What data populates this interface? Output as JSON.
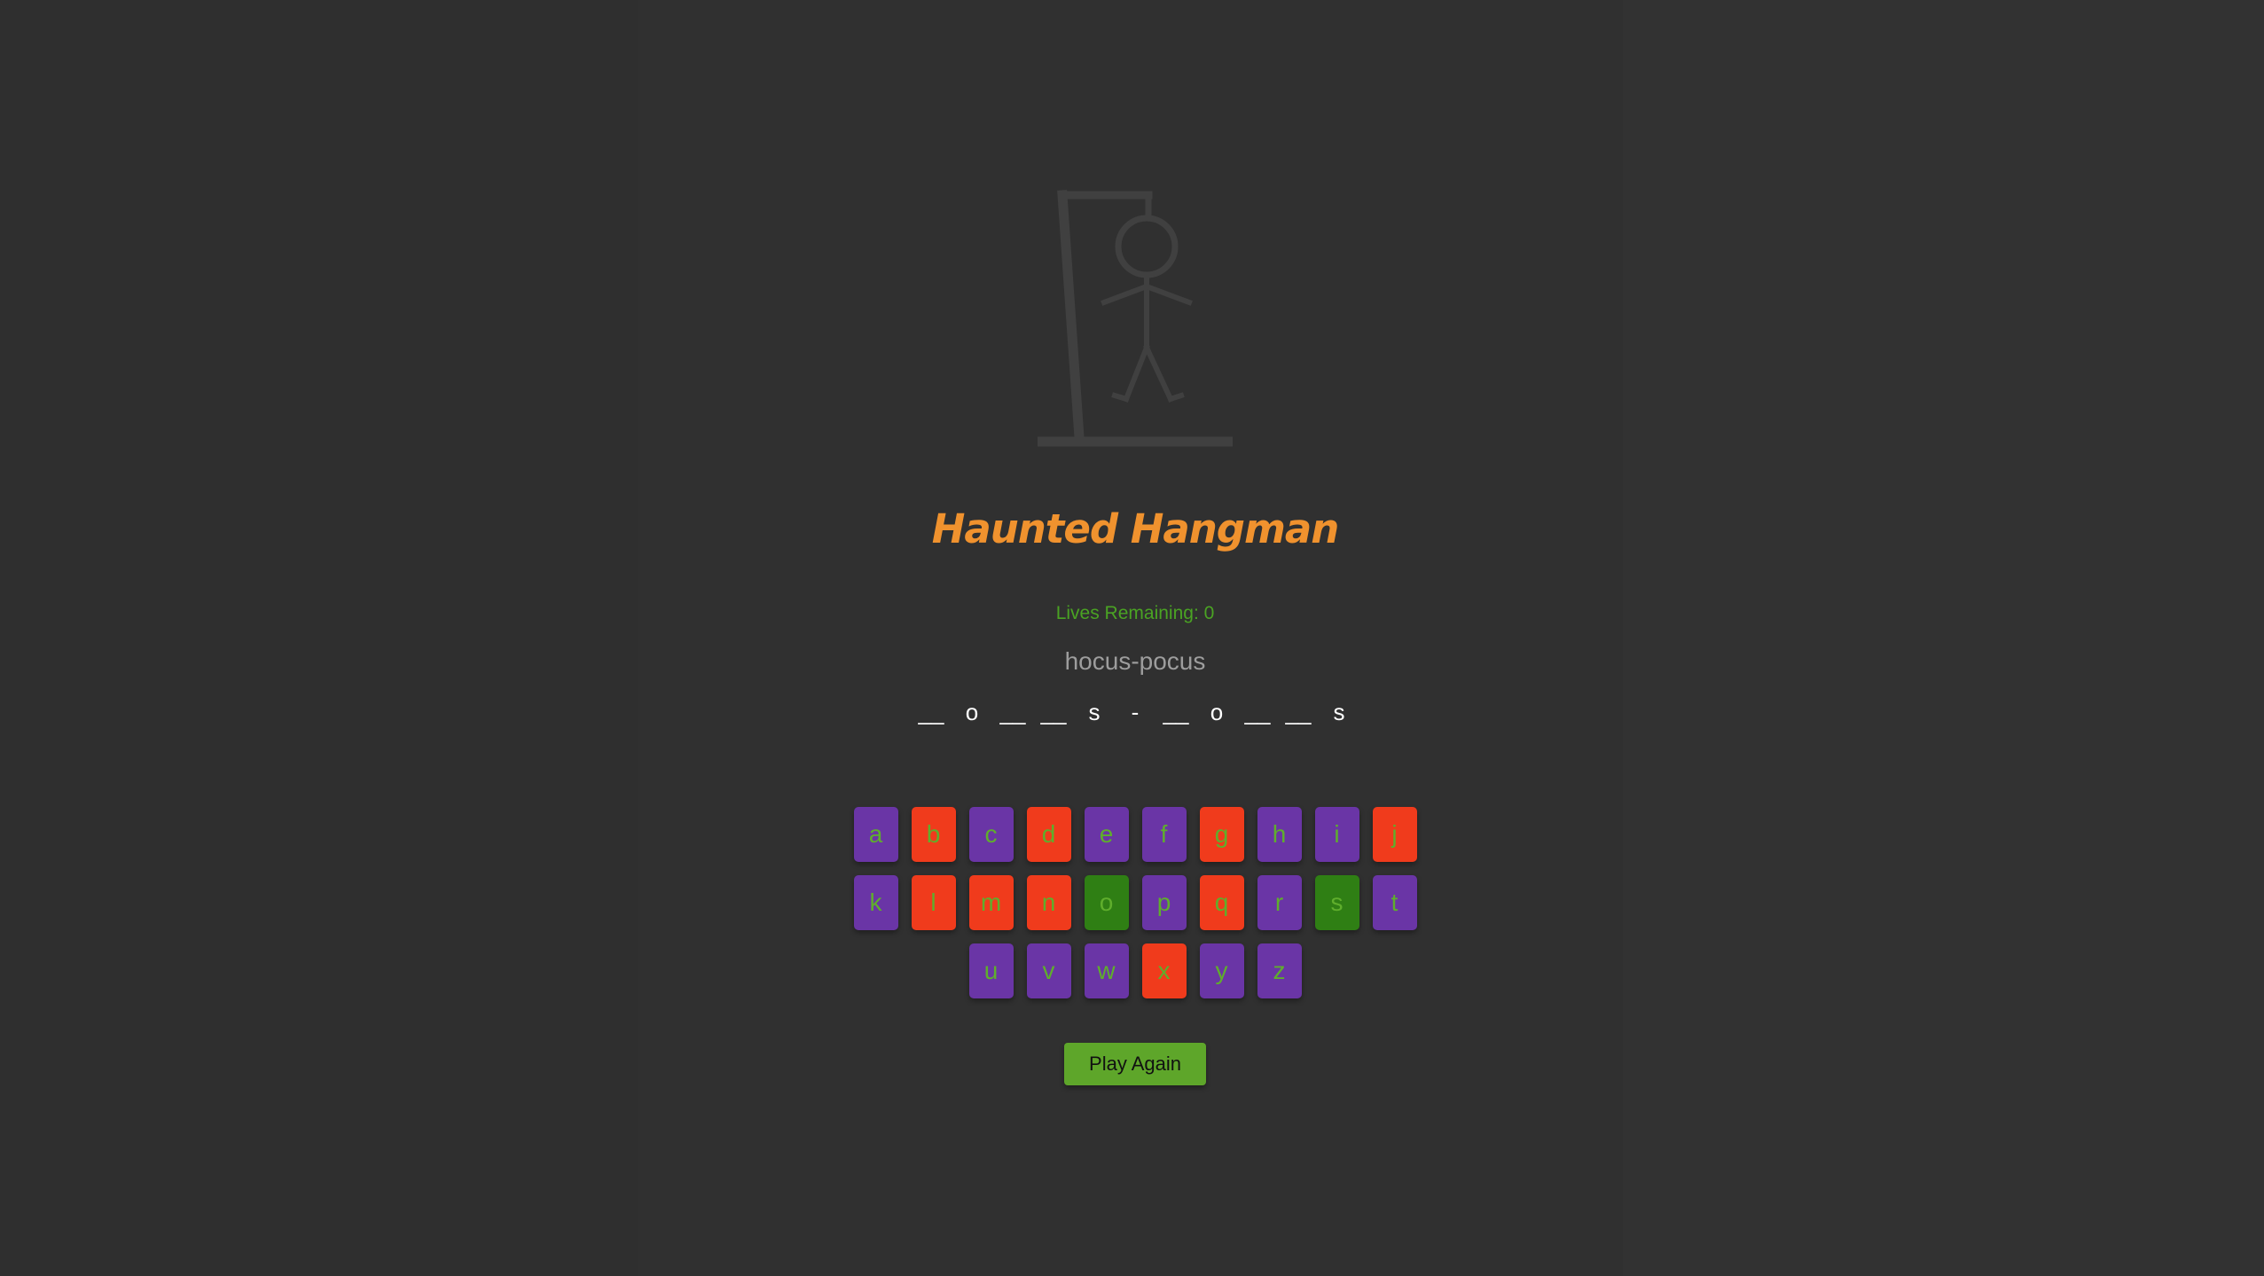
{
  "game": {
    "title": "Haunted Hangman",
    "lives_label": "Lives Remaining: 0",
    "hint": "hocus-pocus",
    "word_slots": [
      "__",
      "o",
      "__",
      "__",
      "s",
      "-",
      "__",
      "o",
      "__",
      "__",
      "s"
    ],
    "play_again_label": "Play Again"
  },
  "keyboard": {
    "rows": [
      [
        {
          "letter": "a",
          "state": "unused"
        },
        {
          "letter": "b",
          "state": "wrong"
        },
        {
          "letter": "c",
          "state": "unused"
        },
        {
          "letter": "d",
          "state": "wrong"
        },
        {
          "letter": "e",
          "state": "unused"
        },
        {
          "letter": "f",
          "state": "unused"
        },
        {
          "letter": "g",
          "state": "wrong"
        },
        {
          "letter": "h",
          "state": "unused"
        },
        {
          "letter": "i",
          "state": "unused"
        },
        {
          "letter": "j",
          "state": "wrong"
        }
      ],
      [
        {
          "letter": "k",
          "state": "unused"
        },
        {
          "letter": "l",
          "state": "wrong"
        },
        {
          "letter": "m",
          "state": "wrong"
        },
        {
          "letter": "n",
          "state": "wrong"
        },
        {
          "letter": "o",
          "state": "correct"
        },
        {
          "letter": "p",
          "state": "unused"
        },
        {
          "letter": "q",
          "state": "wrong"
        },
        {
          "letter": "r",
          "state": "unused"
        },
        {
          "letter": "s",
          "state": "correct"
        },
        {
          "letter": "t",
          "state": "unused"
        }
      ],
      [
        {
          "letter": "u",
          "state": "unused"
        },
        {
          "letter": "v",
          "state": "unused"
        },
        {
          "letter": "w",
          "state": "unused"
        },
        {
          "letter": "x",
          "state": "wrong"
        },
        {
          "letter": "y",
          "state": "unused"
        },
        {
          "letter": "z",
          "state": "unused"
        }
      ]
    ]
  },
  "colors": {
    "background": "#2f2f2f",
    "title": "#f0922e",
    "lives": "#4aa323",
    "hint": "#9d9d9d",
    "key_unused": "#6a35a6",
    "key_wrong": "#f03b1c",
    "key_correct": "#2f7f14",
    "key_text": "#5fae2c",
    "play_again_bg": "#5ea62a",
    "drawing": "#404040"
  },
  "icons": {
    "hangman": "hangman-gallows-icon"
  }
}
